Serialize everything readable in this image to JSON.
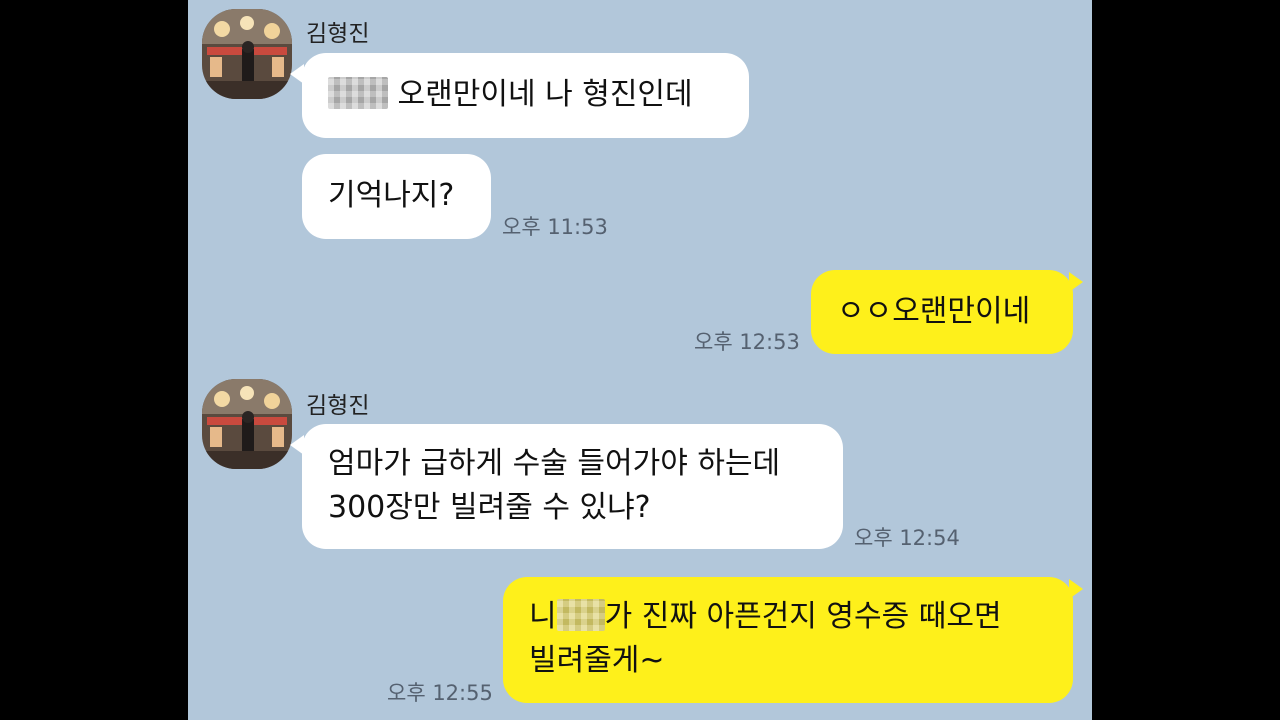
{
  "contact": {
    "name": "김형진",
    "avatar": "carousel-photo"
  },
  "messages": [
    {
      "direction": "in",
      "text": "오랜만이네 나 형진인데",
      "has_redaction": true
    },
    {
      "direction": "in",
      "text": "기억나지?",
      "time": "오후 11:53"
    },
    {
      "direction": "out",
      "text": "ㅇㅇ오랜만이네",
      "time": "오후 12:53"
    },
    {
      "direction": "in",
      "lines": [
        "엄마가 급하게 수술 들어가야 하는데",
        "300장만 빌려줄 수 있냐?"
      ],
      "time": "오후 12:54"
    },
    {
      "direction": "out",
      "line1_prefix": "니",
      "line1_suffix": "가 진짜 아픈건지 영수증 때오면",
      "line2": "빌려줄게~",
      "has_redaction": true,
      "time": "오후 12:55"
    }
  ],
  "colors": {
    "background": "#b2c7da",
    "incoming_bubble": "#ffffff",
    "outgoing_bubble": "#fef01b"
  }
}
